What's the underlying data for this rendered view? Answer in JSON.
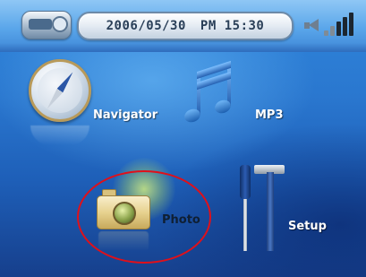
{
  "status_bar": {
    "status_icon": "gps-device-icon",
    "date": "2006/05/30",
    "time": "PM 15:30",
    "volume_icon": "speaker-icon",
    "signal_icon": "signal-strength-icon"
  },
  "menu": [
    {
      "label": "Navigator",
      "icon": "compass-icon"
    },
    {
      "label": "MP3",
      "icon": "music-note-icon"
    },
    {
      "label": "Photo",
      "icon": "camera-icon",
      "selected": true
    },
    {
      "label": "Setup",
      "icon": "tools-icon"
    }
  ],
  "colors": {
    "highlight": "#e0101a",
    "background": "#2a77cf",
    "top_bar": "#5aa6ea"
  }
}
